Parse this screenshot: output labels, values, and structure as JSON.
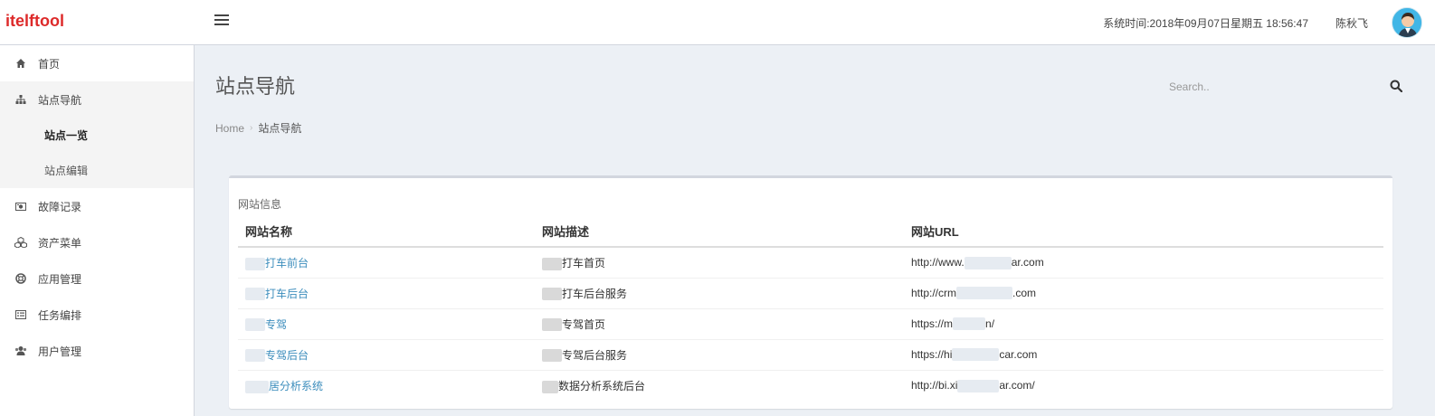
{
  "app": {
    "logo": "itelftool"
  },
  "header": {
    "system_time": "系统时间:2018年09月07日星期五 18:56:47",
    "user_name": "陈秋飞"
  },
  "sidebar": {
    "items": [
      {
        "label": "首页",
        "icon": "home-icon"
      },
      {
        "label": "站点导航",
        "icon": "sitemap-icon",
        "children": [
          {
            "label": "站点一览",
            "active": true
          },
          {
            "label": "站点编辑",
            "active": false
          }
        ]
      },
      {
        "label": "故障记录",
        "icon": "camera-icon"
      },
      {
        "label": "资产菜单",
        "icon": "cubes-icon"
      },
      {
        "label": "应用管理",
        "icon": "lifebuoy-icon"
      },
      {
        "label": "任务编排",
        "icon": "list-card-icon"
      },
      {
        "label": "用户管理",
        "icon": "users-icon"
      }
    ]
  },
  "page": {
    "title": "站点导航",
    "search_placeholder": "Search..",
    "breadcrumb": {
      "home": "Home",
      "current": "站点导航"
    }
  },
  "box": {
    "title": "网站信息",
    "columns": [
      "网站名称",
      "网站描述",
      "网站URL"
    ],
    "rows": [
      {
        "name": "打车前台",
        "desc": "打车首页",
        "url_prefix": "http://www.",
        "url_suffix": "ar.com"
      },
      {
        "name": "打车后台",
        "desc": "打车后台服务",
        "url_prefix": "http://crm",
        "url_suffix": ".com"
      },
      {
        "name": "专驾",
        "desc": "专驾首页",
        "url_prefix": "https://m",
        "url_suffix": "n/"
      },
      {
        "name": "专驾后台",
        "desc": "专驾后台服务",
        "url_prefix": "https://hi",
        "url_suffix": "car.com"
      },
      {
        "name": "居分析系统",
        "desc": "数据分析系统后台",
        "url_prefix": "http://bi.xi",
        "url_suffix": "ar.com/"
      }
    ]
  },
  "colors": {
    "logo": "#dd2a2a",
    "link": "#3c8dbc",
    "content_bg": "#ecf0f5"
  }
}
